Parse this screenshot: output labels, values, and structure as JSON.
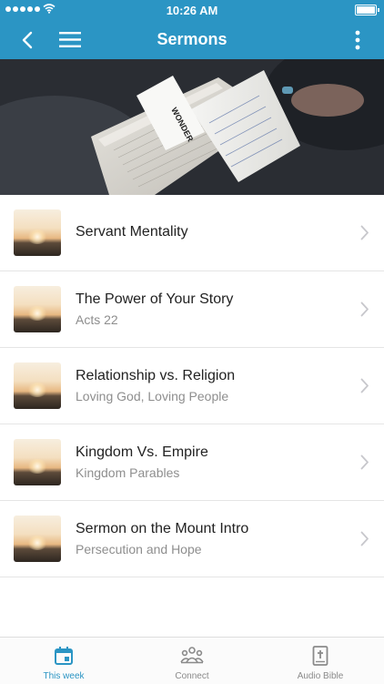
{
  "status": {
    "time": "10:26 AM"
  },
  "nav": {
    "title": "Sermons"
  },
  "hero": {
    "card_text": "WONDER"
  },
  "sermons": [
    {
      "title": "Servant Mentality",
      "subtitle": ""
    },
    {
      "title": "The Power of Your Story",
      "subtitle": "Acts 22"
    },
    {
      "title": "Relationship vs. Religion",
      "subtitle": "Loving God, Loving People"
    },
    {
      "title": "Kingdom Vs. Empire",
      "subtitle": "Kingdom Parables"
    },
    {
      "title": "Sermon on the Mount Intro",
      "subtitle": "Persecution and Hope"
    }
  ],
  "tabs": [
    {
      "label": "This week",
      "icon": "calendar-icon",
      "active": true
    },
    {
      "label": "Connect",
      "icon": "people-icon",
      "active": false
    },
    {
      "label": "Audio Bible",
      "icon": "bible-icon",
      "active": false
    }
  ],
  "colors": {
    "primary": "#2b95c4",
    "inactive": "#8a8a8a"
  }
}
